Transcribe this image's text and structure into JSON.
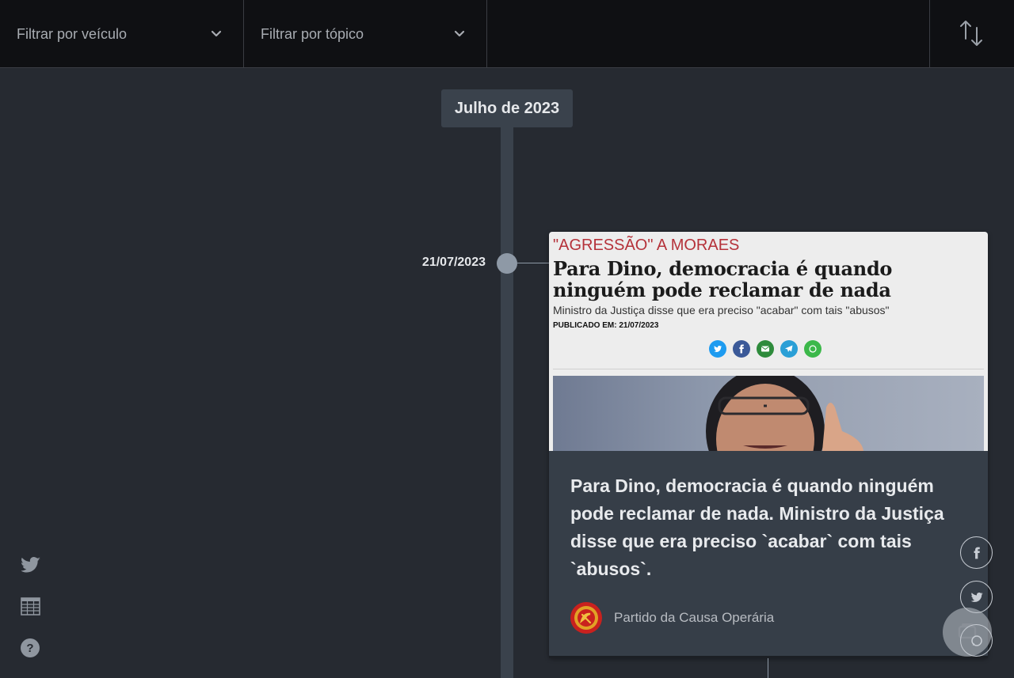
{
  "filters": {
    "vehicle_placeholder": "Filtrar por veículo",
    "topic_placeholder": "Filtrar por tópico"
  },
  "icons": {
    "sort": "sort-arrows-icon",
    "chevron": "chevron-down-icon",
    "twitter": "twitter-icon",
    "table": "table-icon",
    "help": "help-icon",
    "facebook": "facebook-icon",
    "whatsapp": "whatsapp-icon"
  },
  "timeline": {
    "month": "Julho de 2023",
    "entries": [
      {
        "date": "21/07/2023",
        "preview": {
          "kicker": "\"AGRESSÃO\" A MORAES",
          "headline": "Para Dino, democracia é quando ninguém pode reclamar de nada",
          "subheadline": "Ministro da Justiça disse que era preciso \"acabar\" com tais \"abusos\"",
          "published": "PUBLICADO EM: 21/07/2023"
        },
        "text": "Para Dino, democracia é quando ninguém pode reclamar de nada. Ministro da Justiça disse que era preciso `acabar` com tais `abusos`.",
        "source": "Partido da Causa Operária"
      }
    ]
  },
  "help_label": "?",
  "colors": {
    "background": "#262a31",
    "topbar": "#0f1013",
    "timeline": "#3a424c",
    "card": "#363e48",
    "kicker_red": "#b5323a",
    "source_logo": "#c9211e"
  }
}
